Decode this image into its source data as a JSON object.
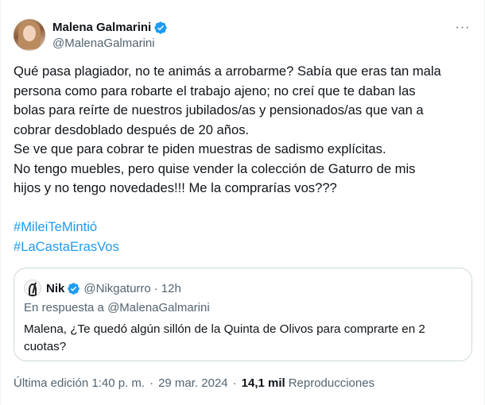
{
  "author": {
    "display_name": "Malena Galmarini",
    "handle": "@MalenaGalmarini",
    "verified_icon": "verified-badge-icon"
  },
  "menu": {
    "more_label": "···"
  },
  "colors": {
    "accent": "#1d9bf0",
    "text": "#0f1419",
    "muted": "#536471",
    "border": "#cfd9de"
  },
  "tweet": {
    "lines": [
      "Qué pasa plagiador, no te animás a arrobarme? Sabía que eras tan mala",
      "persona como para robarte el trabajo ajeno; no creí que te daban las",
      "bolas para reírte de nuestros jubilados/as y pensionados/as que van a",
      "cobrar desdoblado después de 20 años.",
      "Se ve que para cobrar te piden muestras de sadismo explícitas.",
      "No tengo muebles, pero quise vender la colección de Gaturro de mis",
      "hijos y no tengo novedades!!! Me la comprarías vos???"
    ],
    "hashtags": [
      "#MileiTeMintió",
      "#LaCastaErasVos"
    ]
  },
  "quote": {
    "display_name": "Nik",
    "handle": "@Nikgaturro",
    "separator": "·",
    "time": "12h",
    "reply_prefix": "En respuesta a",
    "reply_mention": "@MalenaGalmarini",
    "lines": [
      "Malena, ¿Te quedó algún sillón de la Quinta de Olivos para comprarte en 2",
      "cuotas?"
    ]
  },
  "footer": {
    "edited": "Última edición 1:40 p. m.",
    "separator": "·",
    "date": "29 mar. 2024",
    "views_count": "14,1 mil",
    "views_label": "Reproducciones"
  }
}
